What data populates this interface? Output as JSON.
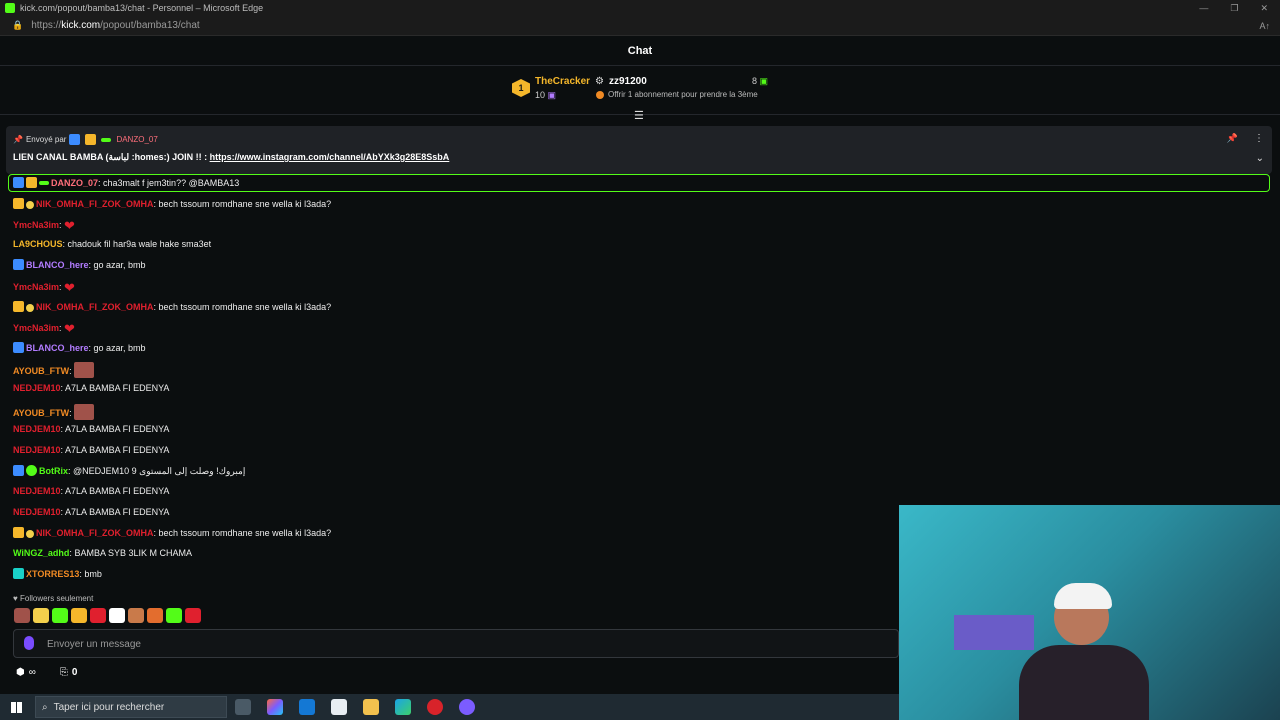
{
  "window": {
    "title": "kick.com/popout/bamba13/chat - Personnel – Microsoft Edge",
    "url_prefix": "https://",
    "url_domain": "kick.com",
    "url_path": "/popout/bamba13/chat"
  },
  "chat": {
    "header": "Chat"
  },
  "leaderboard": {
    "first": {
      "rank": "1",
      "name": "TheCracker",
      "count": "10"
    },
    "second": {
      "name": "zz91200",
      "count": "8",
      "hint": "Offrir 1 abonnement pour prendre la 3ème"
    }
  },
  "pinned": {
    "sent_by": "Envoyé par",
    "user": "DANZO_07",
    "text": "LIEN CANAL BAMBA (لباسة :homes:) JOIN !! : ",
    "link": "https://www.instagram.com/channel/AbYXk3g28E8SsbA"
  },
  "messages": [
    {
      "user": "DANZO_07",
      "color": "#ff6f7b",
      "badges": [
        "mod",
        "crown",
        "bar"
      ],
      "text": "cha3malt f jem3tin?? @BAMBA13"
    },
    {
      "user": "NIK_OMHA_FI_ZOK_OMHA",
      "color": "#e0202e",
      "badges": [
        "crown",
        "gift"
      ],
      "text": "bech tssoum romdhane sne wella ki l3ada?"
    },
    {
      "user": "YmcNa3im",
      "color": "#e0202e",
      "badges": [],
      "text": "",
      "heart": true
    },
    {
      "user": "LA9CHOUS",
      "color": "#f5b72b",
      "badges": [],
      "text": "chadouk fil har9a wale hake sma3et"
    },
    {
      "user": "BLANCO_here",
      "color": "#b27cff",
      "badges": [
        "mod"
      ],
      "text": "go azar, bmb"
    },
    {
      "user": "YmcNa3im",
      "color": "#e0202e",
      "badges": [],
      "text": "",
      "heart": true
    },
    {
      "user": "NIK_OMHA_FI_ZOK_OMHA",
      "color": "#e0202e",
      "badges": [
        "crown",
        "gift"
      ],
      "text": "bech tssoum romdhane sne wella ki l3ada?"
    },
    {
      "user": "YmcNa3im",
      "color": "#e0202e",
      "badges": [],
      "text": "",
      "heart": true
    },
    {
      "user": "BLANCO_here",
      "color": "#b27cff",
      "badges": [
        "mod"
      ],
      "text": "go azar, bmb"
    },
    {
      "user": "AYOUB_FTW",
      "color": "#f08a24",
      "badges": [],
      "text": "",
      "emote": true
    },
    {
      "user": "NEDJEM10",
      "color": "#e0202e",
      "badges": [],
      "text": "A7LA BAMBA FI EDENYA"
    },
    {
      "user": "AYOUB_FTW",
      "color": "#f08a24",
      "badges": [],
      "text": "",
      "emote": true
    },
    {
      "user": "NEDJEM10",
      "color": "#e0202e",
      "badges": [],
      "text": "A7LA BAMBA FI EDENYA"
    },
    {
      "user": "NEDJEM10",
      "color": "#e0202e",
      "badges": [],
      "text": "A7LA BAMBA FI EDENYA"
    },
    {
      "user": "BotRix",
      "color": "#53fc18",
      "badges": [
        "mod",
        "sub"
      ],
      "text": "@NEDJEM10 9 إمبروك! وصلت إلى المستوى"
    },
    {
      "user": "NEDJEM10",
      "color": "#e0202e",
      "badges": [],
      "text": "A7LA BAMBA FI EDENYA"
    },
    {
      "user": "NEDJEM10",
      "color": "#e0202e",
      "badges": [],
      "text": "A7LA BAMBA FI EDENYA"
    },
    {
      "user": "NIK_OMHA_FI_ZOK_OMHA",
      "color": "#e0202e",
      "badges": [
        "crown",
        "gift"
      ],
      "text": "bech tssoum romdhane sne wella ki l3ada?"
    },
    {
      "user": "WiNGZ_adhd",
      "color": "#53fc18",
      "badges": [],
      "text": "BAMBA SYB 3LIK M CHAMA"
    },
    {
      "user": "XTORRES13",
      "color": "#f08a24",
      "badges": [
        "cyan"
      ],
      "text": "bmb"
    }
  ],
  "followers_only": "Followers seulement",
  "emote_colors": [
    "#a0524a",
    "#f3d04c",
    "#53fc18",
    "#f5b72b",
    "#e0202e",
    "#ffffff",
    "#c97a4a",
    "#e36d2e",
    "#53fc18",
    "#e0202e"
  ],
  "input": {
    "placeholder": "Envoyer un message"
  },
  "bottom": {
    "infinity": "∞",
    "points": "0"
  },
  "taskbar": {
    "search_placeholder": "Taper ici pour rechercher"
  }
}
